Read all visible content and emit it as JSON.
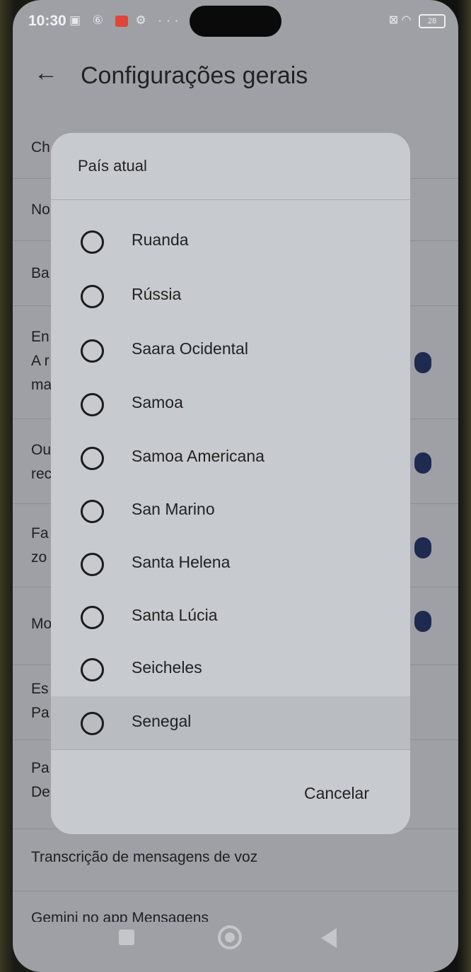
{
  "status_bar": {
    "time": "10:30",
    "left_icons": "N 6 ⚙ ···",
    "battery": "28"
  },
  "app_bar": {
    "back_icon": "arrow-left-icon",
    "title": "Configurações gerais"
  },
  "settings_rows": [
    {
      "text": "Ch"
    },
    {
      "text": "No"
    },
    {
      "text": "Ba"
    },
    {
      "text": "En\nA r\nma"
    },
    {
      "text": "Ou\nrec"
    },
    {
      "text": "Fa\nzo"
    },
    {
      "text": "Mo"
    },
    {
      "text": "Es\nPa"
    },
    {
      "text": "Pa\nDe"
    },
    {
      "text": "Transcrição de mensagens de voz"
    },
    {
      "text": "Gemini no app Mensagens"
    }
  ],
  "dialog": {
    "title": "País atual",
    "options": [
      {
        "label": "Ruanda"
      },
      {
        "label": "Rússia"
      },
      {
        "label": "Saara Ocidental"
      },
      {
        "label": "Samoa"
      },
      {
        "label": "Samoa Americana"
      },
      {
        "label": "San Marino"
      },
      {
        "label": "Santa Helena"
      },
      {
        "label": "Santa Lúcia"
      },
      {
        "label": "Seicheles"
      },
      {
        "label": "Senegal"
      }
    ],
    "cancel_label": "Cancelar"
  },
  "colors": {
    "dialog_bg": "#c7cacf",
    "toggle_on": "#1e2a50"
  }
}
